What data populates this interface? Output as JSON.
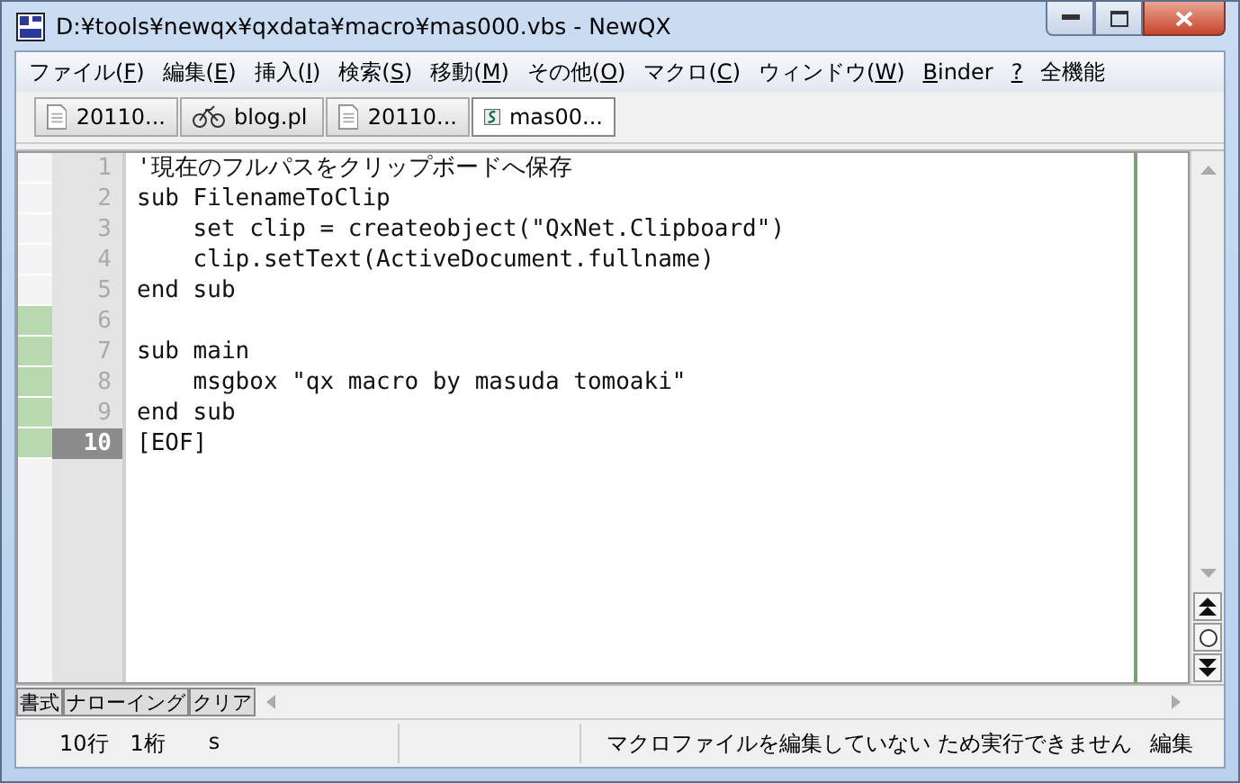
{
  "window": {
    "title": "D:¥tools¥newqx¥qxdata¥macro¥mas000.vbs - NewQX"
  },
  "menu": [
    {
      "before": "ファイル(",
      "key": "F",
      "after": ")"
    },
    {
      "before": "編集(",
      "key": "E",
      "after": ")"
    },
    {
      "before": "挿入(",
      "key": "I",
      "after": ")"
    },
    {
      "before": "検索(",
      "key": "S",
      "after": ")"
    },
    {
      "before": "移動(",
      "key": "M",
      "after": ")"
    },
    {
      "before": "その他(",
      "key": "O",
      "after": ")"
    },
    {
      "before": "マクロ(",
      "key": "C",
      "after": ")"
    },
    {
      "before": "ウィンドウ(",
      "key": "W",
      "after": ")"
    },
    {
      "key": "B",
      "after": "inder"
    },
    {
      "key": "?"
    },
    {
      "before": "全機能"
    }
  ],
  "tabs": [
    {
      "label": "20110...",
      "kind": "document",
      "selected": false
    },
    {
      "label": "blog.pl",
      "kind": "perl",
      "selected": false
    },
    {
      "label": "20110...",
      "kind": "document",
      "selected": false
    },
    {
      "label": "mas00...",
      "kind": "script",
      "selected": true
    }
  ],
  "lines": [
    {
      "number": "1",
      "text": "'現在のフルパスをクリップボードへ保存",
      "modified": false,
      "current": false
    },
    {
      "number": "2",
      "text": "sub FilenameToClip",
      "modified": false,
      "current": false
    },
    {
      "number": "3",
      "text": "    set clip = createobject(\"QxNet.Clipboard\")",
      "modified": false,
      "current": false
    },
    {
      "number": "4",
      "text": "    clip.setText(ActiveDocument.fullname)",
      "modified": false,
      "current": false
    },
    {
      "number": "5",
      "text": "end sub",
      "modified": false,
      "current": false
    },
    {
      "number": "6",
      "modified": true,
      "current": false
    },
    {
      "number": "7",
      "text": "sub main",
      "modified": true,
      "current": false
    },
    {
      "number": "8",
      "text": "    msgbox \"qx macro by masuda tomoaki\"",
      "modified": true,
      "current": false
    },
    {
      "number": "9",
      "text": "end sub",
      "modified": true,
      "current": false
    },
    {
      "number": "10",
      "text": "[EOF]",
      "modified": true,
      "current": true
    }
  ],
  "bottom_buttons": [
    "書式",
    "ナローイング",
    "クリア"
  ],
  "status_bar": [
    "10行",
    "1桁",
    "s",
    "マクロファイルを編集していない ため実行できません",
    "編集"
  ]
}
